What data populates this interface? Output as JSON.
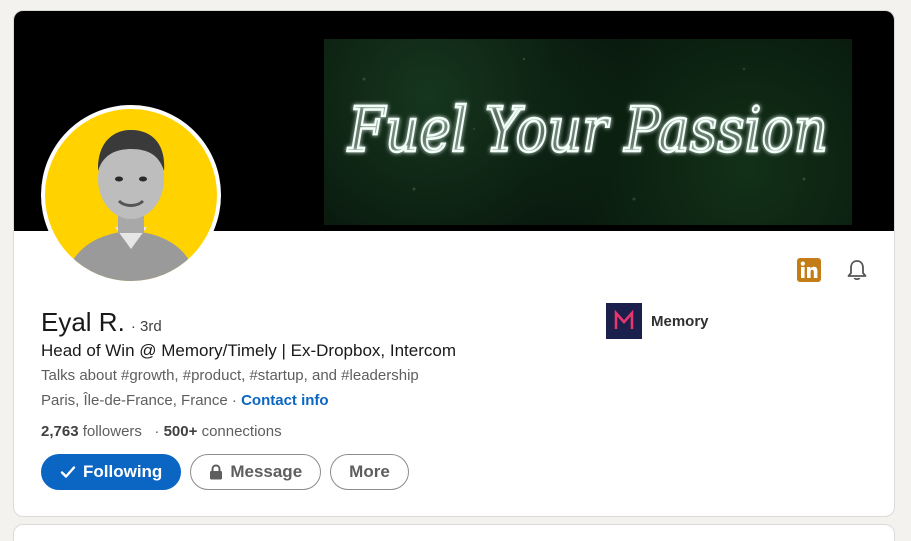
{
  "banner": {
    "text": "Fuel Your Passion"
  },
  "profile": {
    "name": "Eyal R.",
    "degree": "· 3rd",
    "headline": "Head of Win @ Memory/Timely | Ex-Dropbox, Intercom",
    "talks_about": "Talks about #growth, #product, #startup, and #leadership",
    "location": "Paris, Île-de-France, France",
    "location_sep": " · ",
    "contact_info": "Contact info",
    "followers_count": "2,763",
    "followers_label": "followers",
    "stats_sep": "·",
    "connections_count": "500+",
    "connections_label": "connections"
  },
  "company": {
    "name": "Memory",
    "logo_color": "#1b1f4b",
    "logo_accent": "#e8356d"
  },
  "icons": {
    "linkedin": "linkedin-icon",
    "bell": "bell-icon"
  },
  "actions": {
    "following": "Following",
    "message": "Message",
    "more": "More"
  },
  "colors": {
    "primary": "#0a66c2",
    "avatar_bg": "#ffd200",
    "linkedin_gold": "#c37d16"
  }
}
